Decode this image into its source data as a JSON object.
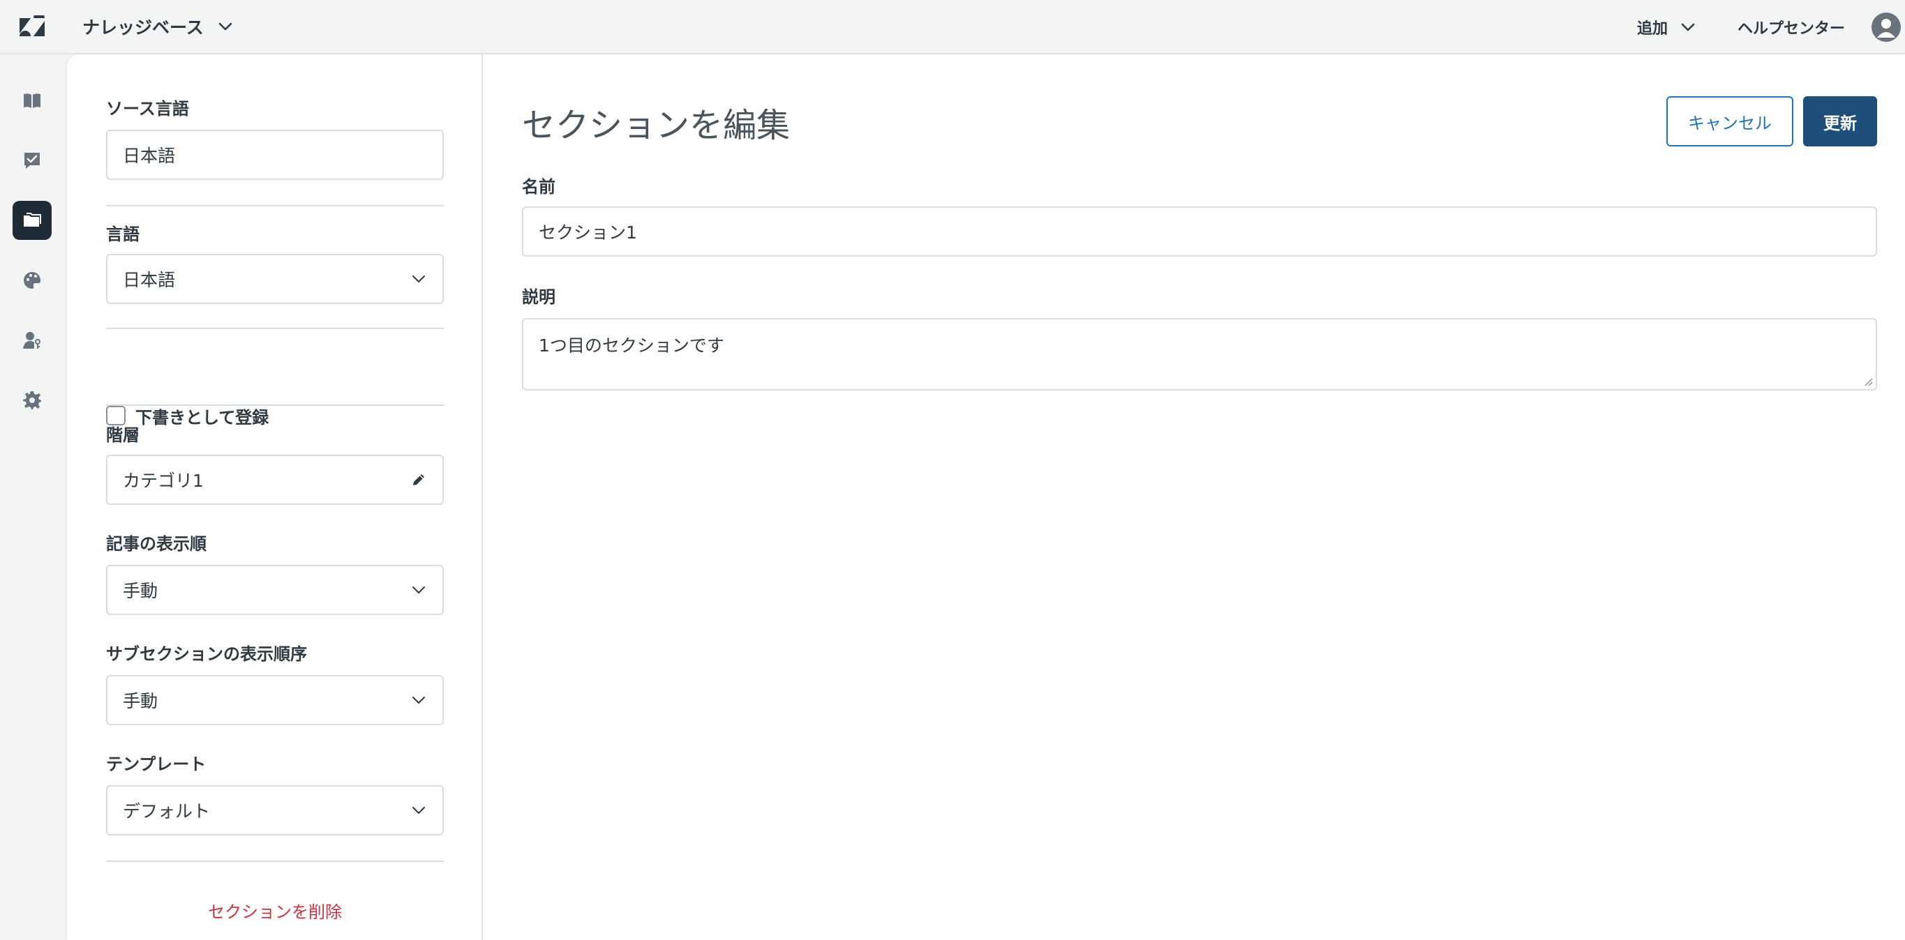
{
  "topbar": {
    "product_name": "ナレッジベース",
    "add_label": "追加",
    "help_center_label": "ヘルプセンター"
  },
  "nav": {
    "items": [
      {
        "icon": "book-icon",
        "active": false
      },
      {
        "icon": "checklist-icon",
        "active": false
      },
      {
        "icon": "folder-icon",
        "active": true
      },
      {
        "icon": "palette-icon",
        "active": false
      },
      {
        "icon": "user-key-icon",
        "active": false
      },
      {
        "icon": "gear-icon",
        "active": false
      }
    ]
  },
  "sidebar": {
    "source_language": {
      "label": "ソース言語",
      "value": "日本語"
    },
    "language": {
      "label": "言語",
      "value": "日本語"
    },
    "draft": {
      "label": "下書きとして登録",
      "checked": false
    },
    "hierarchy": {
      "label": "階層",
      "value": "カテゴリ1"
    },
    "article_order": {
      "label": "記事の表示順",
      "value": "手動"
    },
    "subsection_order": {
      "label": "サブセクションの表示順序",
      "value": "手動"
    },
    "template": {
      "label": "テンプレート",
      "value": "デフォルト"
    },
    "delete_label": "セクションを削除"
  },
  "editor": {
    "title": "セクションを編集",
    "cancel_label": "キャンセル",
    "update_label": "更新",
    "name": {
      "label": "名前",
      "value": "セクション1"
    },
    "description": {
      "label": "説明",
      "value": "1つ目のセクションです"
    }
  },
  "colors": {
    "accent_blue": "#1f73b7",
    "primary_button": "#1f4e79",
    "danger_red": "#cc3340",
    "nav_active": "#1f2c38"
  }
}
